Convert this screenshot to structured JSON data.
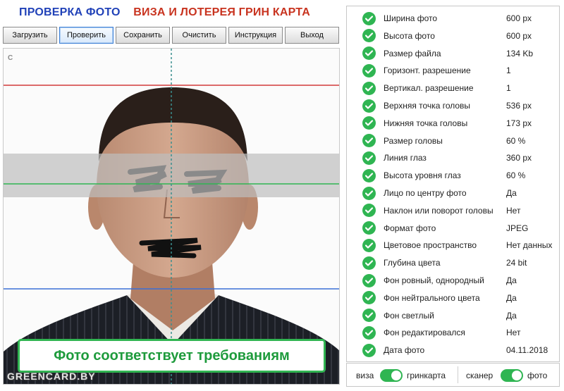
{
  "header": {
    "title_part1": "ПРОВЕРКА ФОТО",
    "title_part2": "ВИЗА И ЛОТЕРЕЯ ГРИН КАРТА"
  },
  "toolbar": {
    "buttons": [
      {
        "label": "Загрузить"
      },
      {
        "label": "Проверить"
      },
      {
        "label": "Сохранить"
      },
      {
        "label": "Очистить"
      },
      {
        "label": "Инструкция"
      },
      {
        "label": "Выход"
      }
    ]
  },
  "photo": {
    "corner_mark": "С",
    "status_message": "Фото соответствует требованиям",
    "watermark": "GREENCARD.BY"
  },
  "checks": [
    {
      "label": "Ширина фото",
      "value": "600 px"
    },
    {
      "label": "Высота фото",
      "value": "600 px"
    },
    {
      "label": "Размер файла",
      "value": "134 Kb"
    },
    {
      "label": "Горизонт. разрешение",
      "value": "1"
    },
    {
      "label": "Вертикал. разрешение",
      "value": "1"
    },
    {
      "label": "Верхняя точка головы",
      "value": "536 px"
    },
    {
      "label": "Нижняя точка головы",
      "value": "173 px"
    },
    {
      "label": "Размер головы",
      "value": "60 %"
    },
    {
      "label": "Линия глаз",
      "value": "360 px"
    },
    {
      "label": "Высота уровня глаз",
      "value": "60 %"
    },
    {
      "label": "Лицо по центру фото",
      "value": "Да"
    },
    {
      "label": "Наклон или поворот головы",
      "value": "Нет"
    },
    {
      "label": "Формат фото",
      "value": "JPEG"
    },
    {
      "label": "Цветовое пространство",
      "value": "Нет данных"
    },
    {
      "label": "Глубина цвета",
      "value": "24 bit"
    },
    {
      "label": "Фон ровный, однородный",
      "value": "Да"
    },
    {
      "label": "Фон нейтрального цвета",
      "value": "Да"
    },
    {
      "label": "Фон светлый",
      "value": "Да"
    },
    {
      "label": "Фон редактировался",
      "value": "Нет"
    },
    {
      "label": "Дата фото",
      "value": "04.11.2018"
    }
  ],
  "switches": {
    "left_off": "виза",
    "left_on": "гринкарта",
    "left_state": true,
    "right_off": "сканер",
    "right_on": "фото",
    "right_state": true
  },
  "colors": {
    "accent_green": "#2fb552",
    "title_blue": "#2142b8",
    "title_red": "#c8331f",
    "guide_red": "#d23b3b",
    "guide_green": "#2fb552",
    "guide_blue": "#3b6fd6",
    "guide_center": "#3a8f8f"
  }
}
